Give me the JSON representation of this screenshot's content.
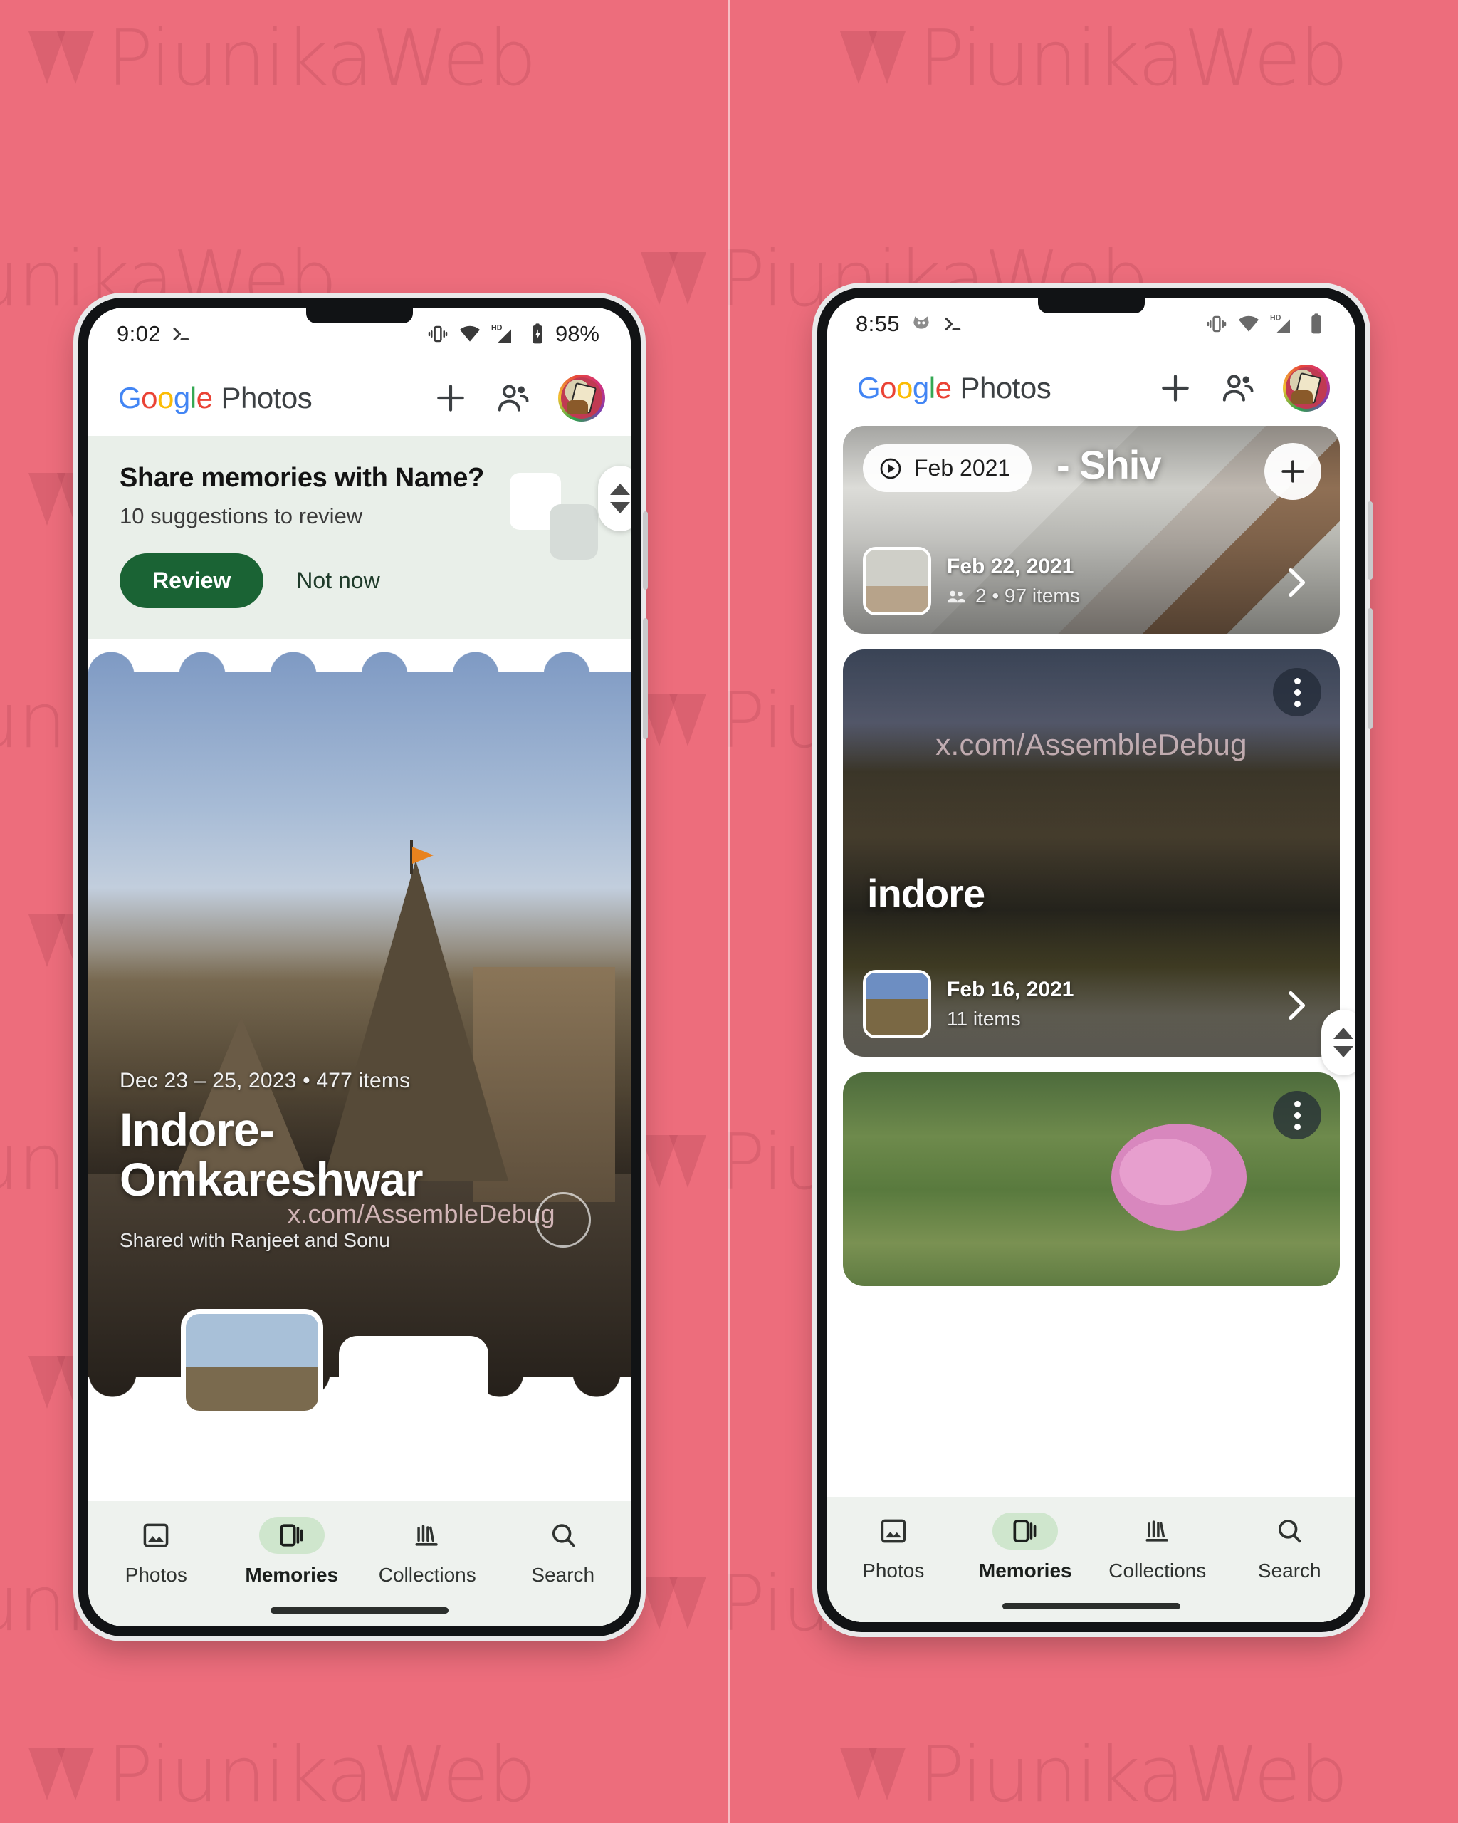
{
  "background": {
    "color": "#ed6d7c",
    "watermark_text": "PiunikaWeb"
  },
  "overlay_watermark": "x.com/AssembleDebug",
  "left_phone": {
    "status_bar": {
      "time": "9:02",
      "battery_percent": "98%",
      "icons": [
        "terminal-icon",
        "vibrate-icon",
        "wifi-icon",
        "hd-signal-icon",
        "battery-icon"
      ]
    },
    "app_bar": {
      "brand_google": "Google",
      "brand_photos": "Photos",
      "actions": [
        "add-icon",
        "sharing-icon",
        "avatar"
      ]
    },
    "suggestion_card": {
      "title": "Share memories with Name?",
      "subtitle": "10 suggestions to review",
      "primary_button": "Review",
      "secondary_button": "Not now",
      "primary_color": "#1a6334"
    },
    "hero_memory": {
      "date_range": "Dec 23 – 25, 2023  •  477 items",
      "title": "Indore-Omkareshwar",
      "shared_with": "Shared with Ranjeet and Sonu"
    },
    "bottom_nav": {
      "active": "Memories",
      "items": [
        {
          "label": "Photos",
          "icon": "photo-icon"
        },
        {
          "label": "Memories",
          "icon": "memories-cards-icon"
        },
        {
          "label": "Collections",
          "icon": "collections-icon"
        },
        {
          "label": "Search",
          "icon": "search-icon"
        }
      ]
    }
  },
  "right_phone": {
    "status_bar": {
      "time": "8:55",
      "icons": [
        "cat-icon",
        "terminal-icon",
        "vibrate-icon",
        "wifi-icon",
        "hd-signal-icon",
        "battery-icon"
      ]
    },
    "app_bar": {
      "brand_google": "Google",
      "brand_photos": "Photos",
      "actions": [
        "add-icon",
        "sharing-icon",
        "avatar"
      ]
    },
    "memory_cards": [
      {
        "pill_label": "Feb 2021",
        "title": "- Shiv",
        "footer_date": "Feb 22, 2021",
        "footer_items": "2 • 97 items",
        "has_plus": true,
        "has_chevron": true
      },
      {
        "title": "indore",
        "footer_date": "Feb 16, 2021",
        "footer_items": "11 items",
        "has_dots": true,
        "has_chevron": true
      },
      {
        "title": "",
        "has_dots": true
      }
    ],
    "bottom_nav": {
      "active": "Memories",
      "items": [
        {
          "label": "Photos",
          "icon": "photo-icon"
        },
        {
          "label": "Memories",
          "icon": "memories-cards-icon"
        },
        {
          "label": "Collections",
          "icon": "collections-icon"
        },
        {
          "label": "Search",
          "icon": "search-icon"
        }
      ]
    }
  }
}
